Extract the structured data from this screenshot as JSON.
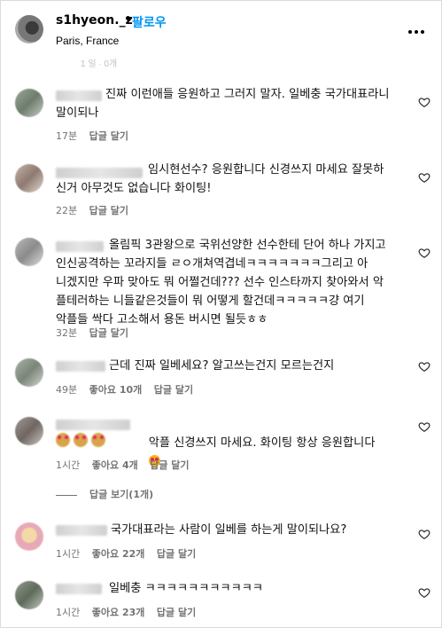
{
  "header": {
    "username": "s1hyeon._z",
    "follow_label": "팔로우",
    "location": "Paris, France",
    "more_icon": "more-horizontal-icon"
  },
  "comments": [
    {
      "text": "진짜 이런애들 응원하고 그러지 말자. 일베충 국가대표라니\n말이되나",
      "time": "17분",
      "reply": "답글 달기"
    },
    {
      "text": "임시현선수? 응원합니다 신경쓰지 마세요 잘못하\n신거 아무것도 없습니다 화이팅!",
      "time": "22분",
      "reply": "답글 달기"
    },
    {
      "text": "올림픽 3관왕으로 국위선양한 선수한테 단어 하나 가지고\n인신공격하는 꼬라지들 ㄹㅇ개쳐역겹네ㅋㅋㅋㅋㅋㅋㅋ그리고 아\n니겠지만 우파 맞아도 뭐 어쩔건데??? 선수 인스타까지 찾아와서 악\n플테러하는 니들같은것들이 뭐 어떻게 할건데ㅋㅋㅋㅋㅋ걍 여기\n악플들 싹다 고소해서 용돈 버시면 될듯ㅎㅎ",
      "time": "32분",
      "reply": "답글 달기"
    },
    {
      "text": "근데 진짜 일베세요? 알고쓰는건지 모르는건지",
      "time": "49분",
      "likes": "좋아요 10개",
      "reply": "답글 달기"
    },
    {
      "text": "악플 신경쓰지 마세요. 화이팅 항상 응원합니다",
      "time": "1시간",
      "likes": "좋아요 4개",
      "reply": "답글 달기"
    },
    {
      "text": "국가대표라는 사람이 일베를 하는게 말이되나요?",
      "time": "1시간",
      "likes": "좋아요 22개",
      "reply": "답글 달기"
    },
    {
      "text": "일베충 ㅋㅋㅋㅋㅋㅋㅋㅋㅋㅋㅋ",
      "time": "1시간",
      "likes": "좋아요 23개",
      "reply": "답글 달기"
    }
  ],
  "view_replies": "답글 보기(1개)",
  "colors": {
    "follow": "#0095f6",
    "meta": "#737373"
  }
}
